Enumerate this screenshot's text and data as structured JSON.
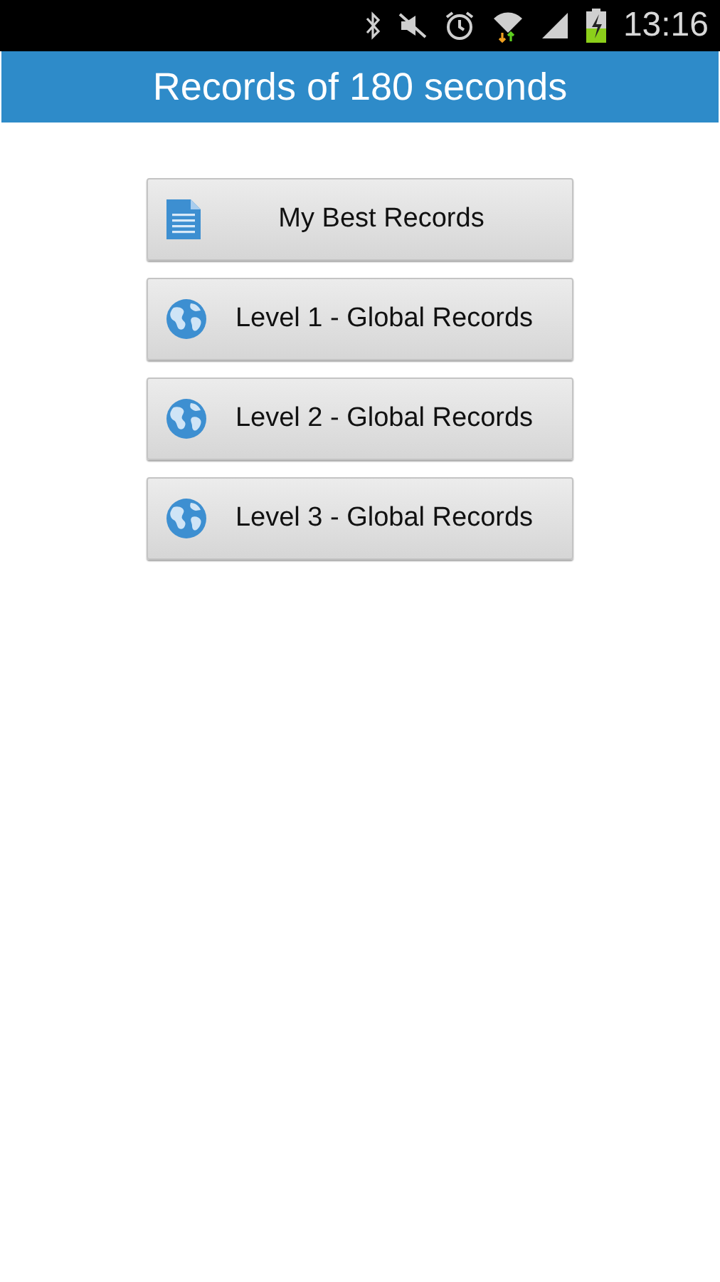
{
  "status_bar": {
    "time": "13:16"
  },
  "title": "Records of 180 seconds",
  "buttons": [
    {
      "kind": "document",
      "label": "My Best Records"
    },
    {
      "kind": "globe",
      "label": "Level 1 - Global Records"
    },
    {
      "kind": "globe",
      "label": "Level 2 - Global Records"
    },
    {
      "kind": "globe",
      "label": "Level 3 - Global Records"
    }
  ]
}
